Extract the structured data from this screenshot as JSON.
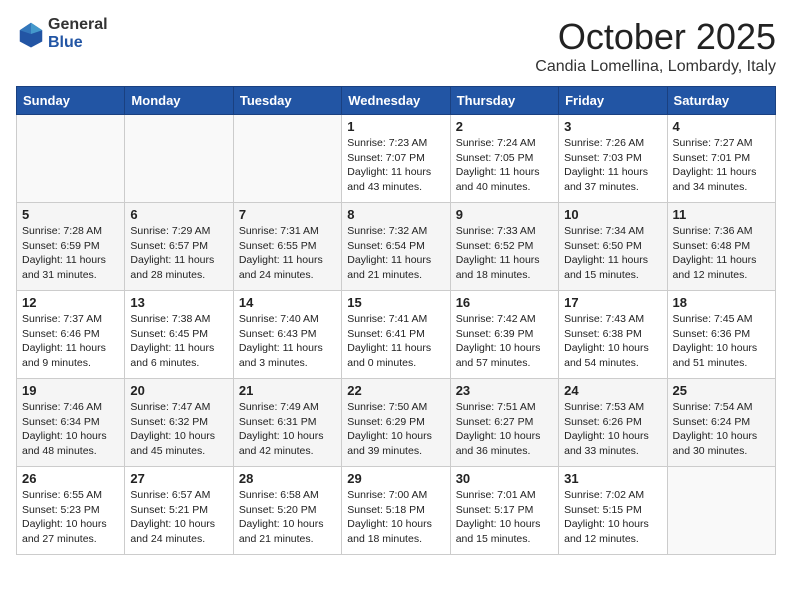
{
  "header": {
    "logo_general": "General",
    "logo_blue": "Blue",
    "month": "October 2025",
    "location": "Candia Lomellina, Lombardy, Italy"
  },
  "weekdays": [
    "Sunday",
    "Monday",
    "Tuesday",
    "Wednesday",
    "Thursday",
    "Friday",
    "Saturday"
  ],
  "weeks": [
    [
      {
        "day": "",
        "info": ""
      },
      {
        "day": "",
        "info": ""
      },
      {
        "day": "",
        "info": ""
      },
      {
        "day": "1",
        "info": "Sunrise: 7:23 AM\nSunset: 7:07 PM\nDaylight: 11 hours and 43 minutes."
      },
      {
        "day": "2",
        "info": "Sunrise: 7:24 AM\nSunset: 7:05 PM\nDaylight: 11 hours and 40 minutes."
      },
      {
        "day": "3",
        "info": "Sunrise: 7:26 AM\nSunset: 7:03 PM\nDaylight: 11 hours and 37 minutes."
      },
      {
        "day": "4",
        "info": "Sunrise: 7:27 AM\nSunset: 7:01 PM\nDaylight: 11 hours and 34 minutes."
      }
    ],
    [
      {
        "day": "5",
        "info": "Sunrise: 7:28 AM\nSunset: 6:59 PM\nDaylight: 11 hours and 31 minutes."
      },
      {
        "day": "6",
        "info": "Sunrise: 7:29 AM\nSunset: 6:57 PM\nDaylight: 11 hours and 28 minutes."
      },
      {
        "day": "7",
        "info": "Sunrise: 7:31 AM\nSunset: 6:55 PM\nDaylight: 11 hours and 24 minutes."
      },
      {
        "day": "8",
        "info": "Sunrise: 7:32 AM\nSunset: 6:54 PM\nDaylight: 11 hours and 21 minutes."
      },
      {
        "day": "9",
        "info": "Sunrise: 7:33 AM\nSunset: 6:52 PM\nDaylight: 11 hours and 18 minutes."
      },
      {
        "day": "10",
        "info": "Sunrise: 7:34 AM\nSunset: 6:50 PM\nDaylight: 11 hours and 15 minutes."
      },
      {
        "day": "11",
        "info": "Sunrise: 7:36 AM\nSunset: 6:48 PM\nDaylight: 11 hours and 12 minutes."
      }
    ],
    [
      {
        "day": "12",
        "info": "Sunrise: 7:37 AM\nSunset: 6:46 PM\nDaylight: 11 hours and 9 minutes."
      },
      {
        "day": "13",
        "info": "Sunrise: 7:38 AM\nSunset: 6:45 PM\nDaylight: 11 hours and 6 minutes."
      },
      {
        "day": "14",
        "info": "Sunrise: 7:40 AM\nSunset: 6:43 PM\nDaylight: 11 hours and 3 minutes."
      },
      {
        "day": "15",
        "info": "Sunrise: 7:41 AM\nSunset: 6:41 PM\nDaylight: 11 hours and 0 minutes."
      },
      {
        "day": "16",
        "info": "Sunrise: 7:42 AM\nSunset: 6:39 PM\nDaylight: 10 hours and 57 minutes."
      },
      {
        "day": "17",
        "info": "Sunrise: 7:43 AM\nSunset: 6:38 PM\nDaylight: 10 hours and 54 minutes."
      },
      {
        "day": "18",
        "info": "Sunrise: 7:45 AM\nSunset: 6:36 PM\nDaylight: 10 hours and 51 minutes."
      }
    ],
    [
      {
        "day": "19",
        "info": "Sunrise: 7:46 AM\nSunset: 6:34 PM\nDaylight: 10 hours and 48 minutes."
      },
      {
        "day": "20",
        "info": "Sunrise: 7:47 AM\nSunset: 6:32 PM\nDaylight: 10 hours and 45 minutes."
      },
      {
        "day": "21",
        "info": "Sunrise: 7:49 AM\nSunset: 6:31 PM\nDaylight: 10 hours and 42 minutes."
      },
      {
        "day": "22",
        "info": "Sunrise: 7:50 AM\nSunset: 6:29 PM\nDaylight: 10 hours and 39 minutes."
      },
      {
        "day": "23",
        "info": "Sunrise: 7:51 AM\nSunset: 6:27 PM\nDaylight: 10 hours and 36 minutes."
      },
      {
        "day": "24",
        "info": "Sunrise: 7:53 AM\nSunset: 6:26 PM\nDaylight: 10 hours and 33 minutes."
      },
      {
        "day": "25",
        "info": "Sunrise: 7:54 AM\nSunset: 6:24 PM\nDaylight: 10 hours and 30 minutes."
      }
    ],
    [
      {
        "day": "26",
        "info": "Sunrise: 6:55 AM\nSunset: 5:23 PM\nDaylight: 10 hours and 27 minutes."
      },
      {
        "day": "27",
        "info": "Sunrise: 6:57 AM\nSunset: 5:21 PM\nDaylight: 10 hours and 24 minutes."
      },
      {
        "day": "28",
        "info": "Sunrise: 6:58 AM\nSunset: 5:20 PM\nDaylight: 10 hours and 21 minutes."
      },
      {
        "day": "29",
        "info": "Sunrise: 7:00 AM\nSunset: 5:18 PM\nDaylight: 10 hours and 18 minutes."
      },
      {
        "day": "30",
        "info": "Sunrise: 7:01 AM\nSunset: 5:17 PM\nDaylight: 10 hours and 15 minutes."
      },
      {
        "day": "31",
        "info": "Sunrise: 7:02 AM\nSunset: 5:15 PM\nDaylight: 10 hours and 12 minutes."
      },
      {
        "day": "",
        "info": ""
      }
    ]
  ]
}
